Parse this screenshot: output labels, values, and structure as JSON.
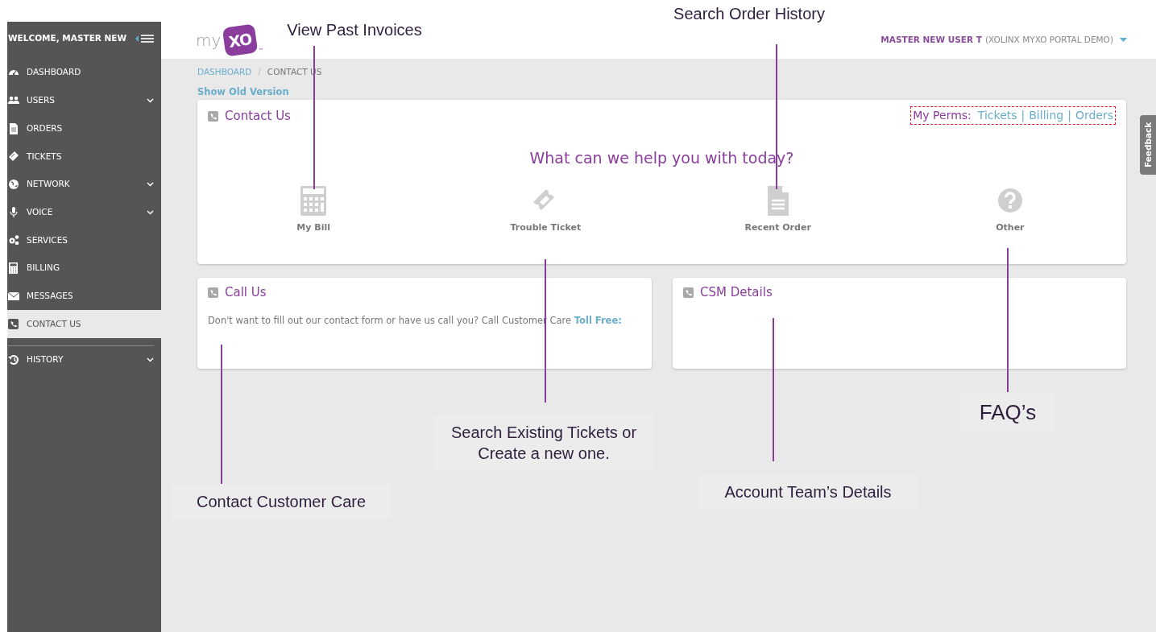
{
  "sidebar": {
    "welcome": "WELCOME, MASTER NEW",
    "items": [
      {
        "label": "DASHBOARD",
        "selected": false,
        "submenu": false
      },
      {
        "label": "USERS",
        "selected": false,
        "submenu": true
      },
      {
        "label": "ORDERS",
        "selected": false,
        "submenu": false
      },
      {
        "label": "TICKETS",
        "selected": false,
        "submenu": false
      },
      {
        "label": "NETWORK",
        "selected": false,
        "submenu": true
      },
      {
        "label": "VOICE",
        "selected": false,
        "submenu": true
      },
      {
        "label": "SERVICES",
        "selected": false,
        "submenu": false
      },
      {
        "label": "BILLING",
        "selected": false,
        "submenu": false
      },
      {
        "label": "MESSAGES",
        "selected": false,
        "submenu": false
      },
      {
        "label": "CONTACT US",
        "selected": true,
        "submenu": false
      }
    ],
    "extra_items": [
      {
        "label": "HISTORY",
        "selected": false,
        "submenu": true
      }
    ]
  },
  "header": {
    "logo_prefix": "my",
    "logo_mark": "XO",
    "logo_tm": "™",
    "user": "MASTER NEW USER T",
    "account": "(XOLINX MYXO PORTAL DEMO)"
  },
  "breadcrumb": [
    "DASHBOARD",
    "CONTACT US"
  ],
  "breadcrumb_separators": [
    "/"
  ],
  "old_version_link": "Show Old Version",
  "contact_card": {
    "title": "Contact Us",
    "perms_label": "My Perms:",
    "perms": [
      "Tickets",
      "Billing",
      "Orders"
    ],
    "perms_separators": [
      "|",
      "|"
    ],
    "question": "What can we help you with today?",
    "options": [
      "My Bill",
      "Trouble Ticket",
      "Recent Order",
      "Other"
    ]
  },
  "call_card": {
    "title": "Call Us",
    "text": "Don't want to fill out our contact form or have us call you? Call Customer Care",
    "toll_free": "Toll Free:"
  },
  "csm_card": {
    "title": "CSM Details"
  },
  "feedback_tab": "Feedback",
  "callouts": [
    {
      "text": "View Past Invoices",
      "kind": "plain"
    },
    {
      "text": "Search Order History",
      "kind": "plain"
    },
    {
      "text": "Search Existing Tickets or Create a new one.",
      "kind": "boxed"
    },
    {
      "text": "Contact Customer Care",
      "kind": "boxed"
    },
    {
      "text": "Account Team’s Details",
      "kind": "boxed"
    },
    {
      "text": "FAQ’s",
      "kind": "boxed"
    }
  ]
}
